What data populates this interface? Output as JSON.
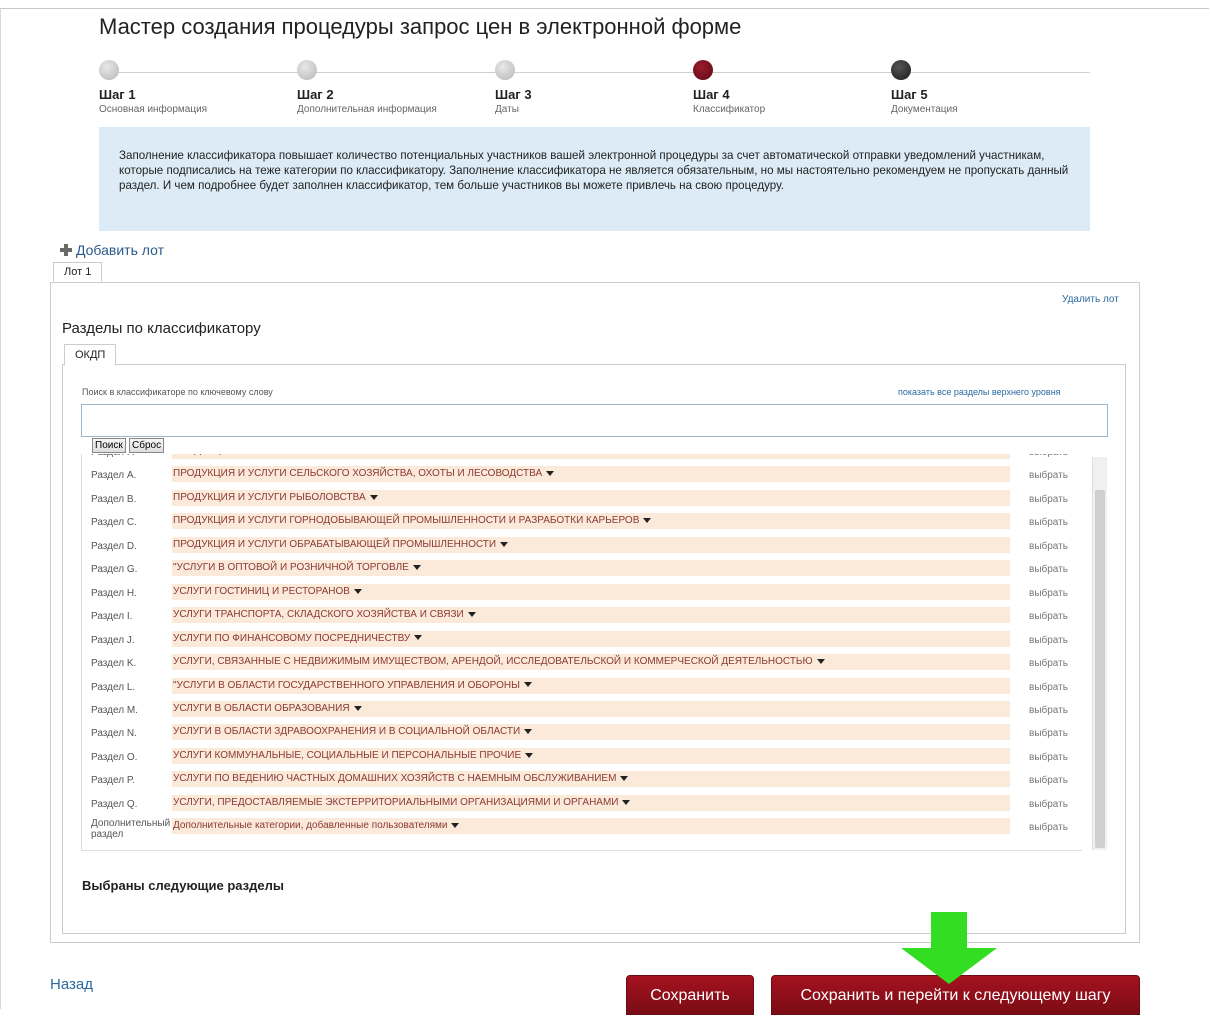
{
  "title": "Мастер создания процедуры запрос цен в электронной форме",
  "steps": [
    {
      "title": "Шаг 1",
      "sub": "Основная информация",
      "state": "done"
    },
    {
      "title": "Шаг 2",
      "sub": "Дополнительная информация",
      "state": "done"
    },
    {
      "title": "Шаг 3",
      "sub": "Даты",
      "state": "done"
    },
    {
      "title": "Шаг 4",
      "sub": "Классификатор",
      "state": "active"
    },
    {
      "title": "Шаг 5",
      "sub": "Документация",
      "state": "next"
    }
  ],
  "info": "Заполнение классификатора повышает количество потенциальных участников вашей электронной процедуры за счет автоматической отправки уведомлений участникам, которые подписались на теже категории по классификатору. Заполнение классификатора не является обязательным, но мы настоятельно рекомендуем не пропускать данный раздел. И чем подробнее будет заполнен классификатор, тем больше участников вы можете привлечь на свою процедуру.",
  "add_lot": "Добавить лот",
  "lot_tab": "Лот 1",
  "delete_lot": "Удалить лот",
  "sections_title": "Разделы по классификатору",
  "classifier_tab": "ОКДП",
  "search": {
    "label": "Поиск в классификаторе по ключевому слову",
    "show_all": "показать все разделы верхнего уровня",
    "value": "",
    "search_button": "Поиск",
    "reset_button": "Сброс"
  },
  "pick_label": "выбрать",
  "rows": [
    {
      "code": "Раздел F.",
      "name": "ПРОДУКЦИЯ И УСЛУГИ СТРОИТЕЛЬСТВА"
    },
    {
      "code": "Раздел A.",
      "name": "ПРОДУКЦИЯ И УСЛУГИ СЕЛЬСКОГО ХОЗЯЙСТВА, ОХОТЫ И ЛЕСОВОДСТВА"
    },
    {
      "code": "Раздел B.",
      "name": "ПРОДУКЦИЯ И УСЛУГИ РЫБОЛОВСТВА"
    },
    {
      "code": "Раздел C.",
      "name": "ПРОДУКЦИЯ И УСЛУГИ ГОРНОДОБЫВАЮЩЕЙ ПРОМЫШЛЕННОСТИ И РАЗРАБОТКИ КАРЬЕРОВ"
    },
    {
      "code": "Раздел D.",
      "name": "ПРОДУКЦИЯ И УСЛУГИ ОБРАБАТЫВАЮЩЕЙ ПРОМЫШЛЕННОСТИ"
    },
    {
      "code": "Раздел G.",
      "name": "\"УСЛУГИ В ОПТОВОЙ И РОЗНИЧНОЙ ТОРГОВЛЕ"
    },
    {
      "code": "Раздел H.",
      "name": "УСЛУГИ ГОСТИНИЦ И РЕСТОРАНОВ"
    },
    {
      "code": "Раздел I.",
      "name": "УСЛУГИ ТРАНСПОРТА, СКЛАДСКОГО ХОЗЯЙСТВА И СВЯЗИ"
    },
    {
      "code": "Раздел J.",
      "name": "УСЛУГИ ПО ФИНАНСОВОМУ ПОСРЕДНИЧЕСТВУ"
    },
    {
      "code": "Раздел K.",
      "name": "УСЛУГИ, СВЯЗАННЫЕ С НЕДВИЖИМЫМ ИМУЩЕСТВОМ, АРЕНДОЙ, ИССЛЕДОВАТЕЛЬСКОЙ И КОММЕРЧЕСКОЙ ДЕЯТЕЛЬНОСТЬЮ"
    },
    {
      "code": "Раздел L.",
      "name": "\"УСЛУГИ В ОБЛАСТИ ГОСУДАРСТВЕННОГО УПРАВЛЕНИЯ И ОБОРОНЫ"
    },
    {
      "code": "Раздел M.",
      "name": "УСЛУГИ В ОБЛАСТИ ОБРАЗОВАНИЯ"
    },
    {
      "code": "Раздел N.",
      "name": "УСЛУГИ В ОБЛАСТИ ЗДРАВООХРАНЕНИЯ И В СОЦИАЛЬНОЙ ОБЛАСТИ"
    },
    {
      "code": "Раздел O.",
      "name": "УСЛУГИ КОММУНАЛЬНЫЕ, СОЦИАЛЬНЫЕ И ПЕРСОНАЛЬНЫЕ ПРОЧИЕ"
    },
    {
      "code": "Раздел P.",
      "name": "УСЛУГИ ПО ВЕДЕНИЮ ЧАСТНЫХ ДОМАШНИХ ХОЗЯЙСТВ С НАЕМНЫМ ОБСЛУЖИВАНИЕМ"
    },
    {
      "code": "Раздел Q.",
      "name": "УСЛУГИ, ПРЕДОСТАВЛЯЕМЫЕ ЭКСТЕРРИТОРИАЛЬНЫМИ ОРГАНИЗАЦИЯМИ И ОРГАНАМИ"
    },
    {
      "code": "Дополнительный раздел",
      "name": "Дополнительные категории, добавленные пользователями"
    }
  ],
  "chosen_title": "Выбраны следующие разделы",
  "back": "Назад",
  "save": "Сохранить",
  "save_next": "Сохранить и перейти к следующему шагу",
  "colors": {
    "accent": "#8a0f1c",
    "info_bg": "#dcebf5",
    "row_bg": "#fbe9d9",
    "arrow": "#33dd22"
  }
}
